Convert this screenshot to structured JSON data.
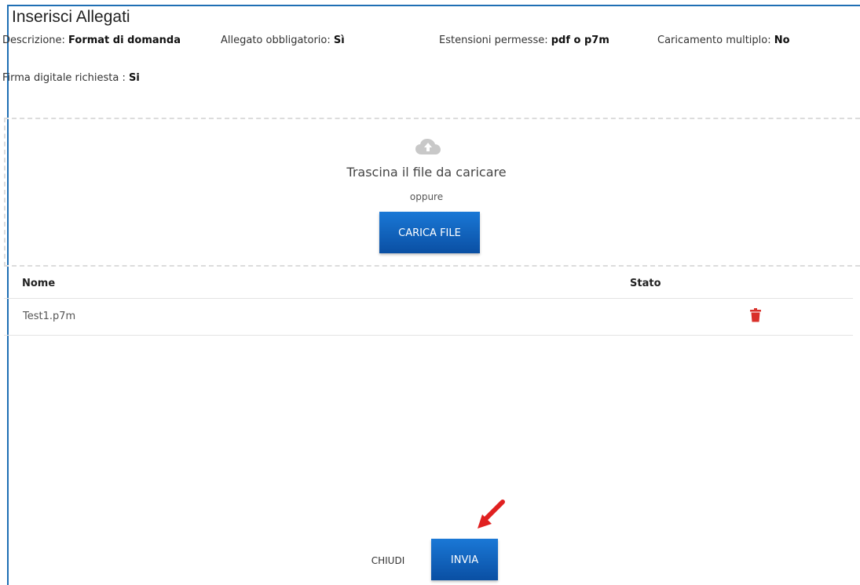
{
  "dialog": {
    "title": "Inserisci Allegati",
    "meta": {
      "descrizione_label": "Descrizione:",
      "descrizione_value": "Format di domanda",
      "obbligatorio_label": "Allegato obbligatorio:",
      "obbligatorio_value": "Sì",
      "estensioni_label": "Estensioni permesse:",
      "estensioni_value": "pdf o p7m",
      "multiplo_label": "Caricamento multiplo:",
      "multiplo_value": "No",
      "firma_label": "Firma digitale richiesta :",
      "firma_value": "Si"
    },
    "dropzone": {
      "icon": "cloud-upload-icon",
      "title": "Trascina il file da caricare",
      "or_text": "oppure",
      "button_label": "CARICA FILE"
    },
    "table": {
      "columns": [
        "Nome",
        "Stato"
      ],
      "rows": [
        {
          "nome": "Test1.p7m",
          "action_icon": "trash-icon"
        }
      ]
    },
    "footer": {
      "close_label": "CHIUDI",
      "submit_label": "INVIA"
    },
    "colors": {
      "primary": "#0a5cb8",
      "border": "#1f6fb4",
      "delete": "#d9302a",
      "annotation_arrow": "#e02020"
    }
  }
}
